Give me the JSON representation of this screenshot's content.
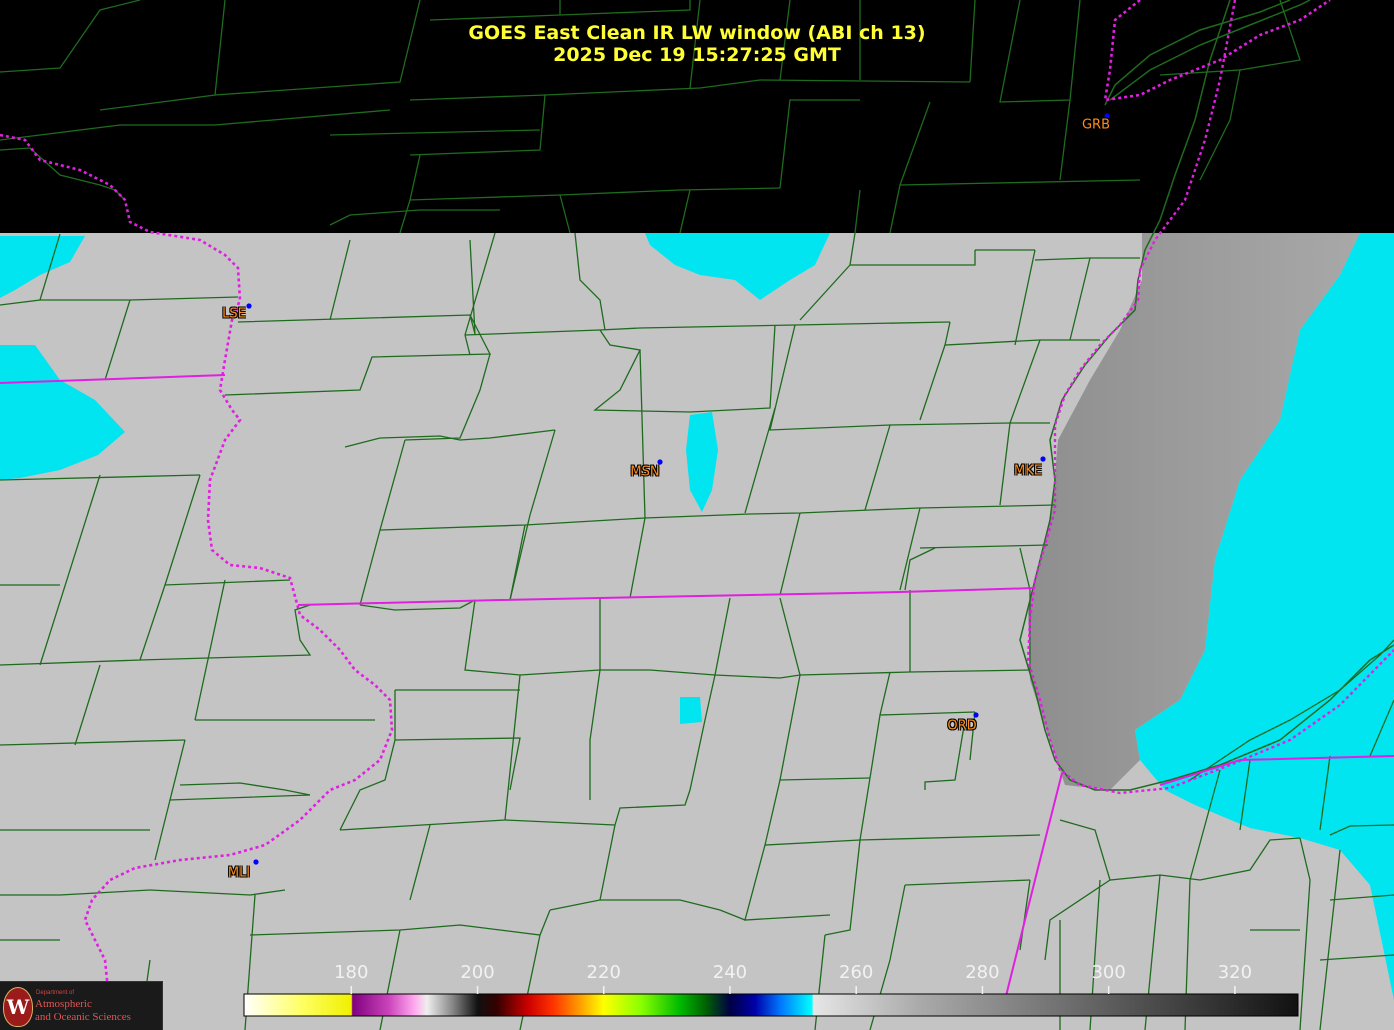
{
  "title": {
    "line1": "GOES East Clean IR LW window (ABI ch 13)",
    "line2": "2025 Dec 19  15:27:25 GMT"
  },
  "colorbar": {
    "tick_labels": [
      "180",
      "200",
      "220",
      "240",
      "260",
      "280",
      "300",
      "320"
    ],
    "ticks": [
      180,
      200,
      220,
      240,
      260,
      280,
      300,
      320
    ],
    "range": [
      163,
      330
    ],
    "stops": [
      {
        "value": 163,
        "color": "#ffffff"
      },
      {
        "value": 172,
        "color": "#ffff66"
      },
      {
        "value": 180,
        "color": "#f0f000"
      },
      {
        "value": 180.2,
        "color": "#800080"
      },
      {
        "value": 186,
        "color": "#cc44bb"
      },
      {
        "value": 190,
        "color": "#ffaaee"
      },
      {
        "value": 192,
        "color": "#eeeeee"
      },
      {
        "value": 196,
        "color": "#888888"
      },
      {
        "value": 200,
        "color": "#111111"
      },
      {
        "value": 203,
        "color": "#330000"
      },
      {
        "value": 208,
        "color": "#cc0000"
      },
      {
        "value": 212,
        "color": "#ff3300"
      },
      {
        "value": 216,
        "color": "#ff9900"
      },
      {
        "value": 220,
        "color": "#ffff00"
      },
      {
        "value": 226,
        "color": "#88ff00"
      },
      {
        "value": 232,
        "color": "#00bb00"
      },
      {
        "value": 236,
        "color": "#006600"
      },
      {
        "value": 240,
        "color": "#000044"
      },
      {
        "value": 244,
        "color": "#0000aa"
      },
      {
        "value": 248,
        "color": "#0077ff"
      },
      {
        "value": 253,
        "color": "#00ffff"
      },
      {
        "value": 253.2,
        "color": "#e6e6e6"
      },
      {
        "value": 270,
        "color": "#aaaaaa"
      },
      {
        "value": 290,
        "color": "#777777"
      },
      {
        "value": 310,
        "color": "#444444"
      },
      {
        "value": 330,
        "color": "#111111"
      }
    ]
  },
  "stations": [
    {
      "id": "GRB",
      "label": "GRB"
    },
    {
      "id": "LSE",
      "label": "LSE"
    },
    {
      "id": "MSN",
      "label": "MSN"
    },
    {
      "id": "MKE",
      "label": "MKE"
    },
    {
      "id": "ORD",
      "label": "ORD"
    },
    {
      "id": "MLI",
      "label": "MLI"
    }
  ],
  "colors": {
    "county_lines": "#1e6b1e",
    "state_lines": "#e020e0",
    "station_dot": "#0000ff",
    "station_label": "#ff8c1a",
    "title": "#ffff33",
    "cloud_cold": "#00e5f0",
    "surface": "#c4c4c4",
    "lake": "#909090"
  },
  "logo": {
    "dept": "Department of",
    "line1": "Atmospheric",
    "line2": "and Oceanic Sciences",
    "seal_letter": "W"
  }
}
